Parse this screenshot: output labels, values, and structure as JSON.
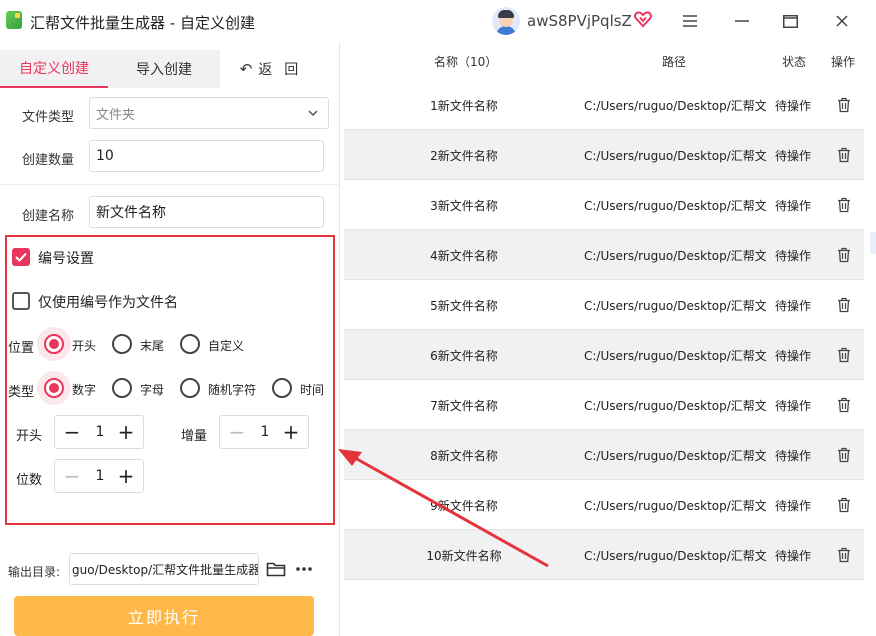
{
  "window": {
    "title": "汇帮文件批量生成器 - 自定义创建",
    "username": "awS8PVjPqlsZ"
  },
  "tabs": {
    "custom": "自定义创建",
    "import": "导入创建",
    "back": "返回"
  },
  "form": {
    "file_type_label": "文件类型",
    "file_type_value": "文件夹",
    "count_label": "创建数量",
    "count_value": "10",
    "name_label": "创建名称",
    "name_value": "新文件名称"
  },
  "numbering": {
    "enable_label": "编号设置",
    "enabled": true,
    "only_number_label": "仅使用编号作为文件名",
    "only_number": false,
    "position_label": "位置",
    "position_options": [
      "开头",
      "末尾",
      "自定义"
    ],
    "position_selected": "开头",
    "type_label": "类型",
    "type_options": [
      "数字",
      "字母",
      "随机字符",
      "时间"
    ],
    "type_selected": "数字",
    "start_label": "开头",
    "start_value": "1",
    "step_label": "增量",
    "step_value": "1",
    "digits_label": "位数",
    "digits_value": "1"
  },
  "output": {
    "label": "输出目录:",
    "path": "guo/Desktop/汇帮文件批量生成器"
  },
  "run_button": "立即执行",
  "table": {
    "headers": {
      "name": "名称（10）",
      "path": "路径",
      "status": "状态",
      "op": "操作"
    },
    "rows": [
      {
        "name": "1新文件名称",
        "path": "C:/Users/ruguo/Desktop/汇帮文",
        "status": "待操作"
      },
      {
        "name": "2新文件名称",
        "path": "C:/Users/ruguo/Desktop/汇帮文",
        "status": "待操作"
      },
      {
        "name": "3新文件名称",
        "path": "C:/Users/ruguo/Desktop/汇帮文",
        "status": "待操作"
      },
      {
        "name": "4新文件名称",
        "path": "C:/Users/ruguo/Desktop/汇帮文",
        "status": "待操作"
      },
      {
        "name": "5新文件名称",
        "path": "C:/Users/ruguo/Desktop/汇帮文",
        "status": "待操作"
      },
      {
        "name": "6新文件名称",
        "path": "C:/Users/ruguo/Desktop/汇帮文",
        "status": "待操作"
      },
      {
        "name": "7新文件名称",
        "path": "C:/Users/ruguo/Desktop/汇帮文",
        "status": "待操作"
      },
      {
        "name": "8新文件名称",
        "path": "C:/Users/ruguo/Desktop/汇帮文",
        "status": "待操作"
      },
      {
        "name": "9新文件名称",
        "path": "C:/Users/ruguo/Desktop/汇帮文",
        "status": "待操作"
      },
      {
        "name": "10新文件名称",
        "path": "C:/Users/ruguo/Desktop/汇帮文",
        "status": "待操作"
      }
    ]
  },
  "icons": {
    "logo": "app-logo-icon",
    "vip": "heart-badge-icon",
    "menu": "hamburger-icon",
    "minimize": "minimize-icon",
    "maximize": "maximize-icon",
    "close": "close-icon",
    "dropdown": "chevron-down-icon",
    "back": "undo-arrow-icon",
    "folder": "folder-icon",
    "more": "more-dots-icon",
    "delete": "trash-icon"
  },
  "colors": {
    "accent": "#e8365d",
    "run_button": "#ffb84a",
    "annotation": "#e5333a",
    "row_alt": "#f1f1f4"
  }
}
